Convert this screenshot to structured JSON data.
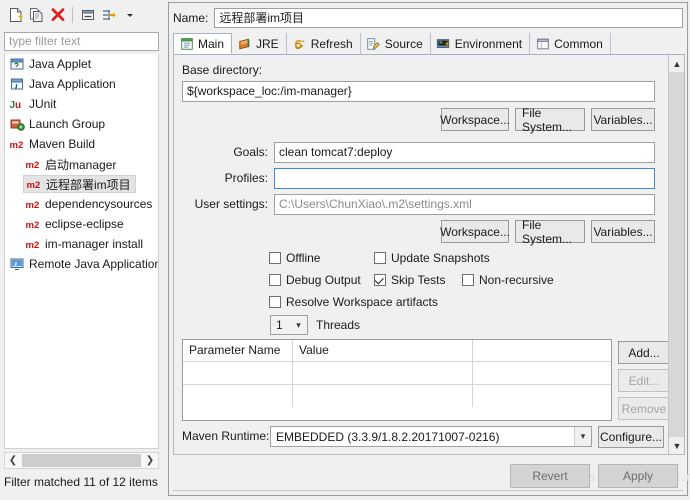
{
  "left_toolbar": {
    "buttons": [
      {
        "name": "new-launch-configuration-icon",
        "label": "New"
      },
      {
        "name": "duplicate-launch-configuration-icon",
        "label": "Duplicate"
      },
      {
        "name": "delete-launch-configuration-icon",
        "label": "Delete"
      },
      {
        "name": "collapse-all-icon",
        "label": "Collapse All"
      },
      {
        "name": "filter-launch-configurations-icon",
        "label": "Filter"
      },
      {
        "name": "view-menu-chevron-icon",
        "label": "View Menu"
      }
    ]
  },
  "filter": {
    "placeholder": "type filter text",
    "value": "",
    "status": "Filter matched 11 of 12 items"
  },
  "tree": {
    "items": [
      {
        "label": "Java Applet",
        "icon": "java-applet-icon",
        "indent": false,
        "selected": false
      },
      {
        "label": "Java Application",
        "icon": "java-application-icon",
        "indent": false,
        "selected": false
      },
      {
        "label": "JUnit",
        "icon": "junit-icon",
        "indent": false,
        "selected": false
      },
      {
        "label": "Launch Group",
        "icon": "launch-group-icon",
        "indent": false,
        "selected": false
      },
      {
        "label": "Maven Build",
        "icon": "maven-icon",
        "indent": false,
        "selected": false
      },
      {
        "label": "启动manager",
        "icon": "maven-icon",
        "indent": true,
        "selected": false
      },
      {
        "label": "远程部署im项目",
        "icon": "maven-icon",
        "indent": true,
        "selected": true
      },
      {
        "label": "dependencysources",
        "icon": "maven-icon",
        "indent": true,
        "selected": false
      },
      {
        "label": "eclipse-eclipse",
        "icon": "maven-icon",
        "indent": true,
        "selected": false
      },
      {
        "label": "im-manager install",
        "icon": "maven-icon",
        "indent": true,
        "selected": false
      },
      {
        "label": "Remote Java Application",
        "icon": "remote-java-application-icon",
        "indent": false,
        "selected": false
      }
    ]
  },
  "name_field": {
    "label": "Name:",
    "value": "远程部署im项目"
  },
  "tabs": [
    {
      "label": "Main",
      "icon": "main-tab-icon",
      "active": true
    },
    {
      "label": "JRE",
      "icon": "jre-tab-icon",
      "active": false
    },
    {
      "label": "Refresh",
      "icon": "refresh-tab-icon",
      "active": false
    },
    {
      "label": "Source",
      "icon": "source-tab-icon",
      "active": false
    },
    {
      "label": "Environment",
      "icon": "environment-tab-icon",
      "active": false
    },
    {
      "label": "Common",
      "icon": "common-tab-icon",
      "active": false
    }
  ],
  "main_tab": {
    "base_directory": {
      "label": "Base directory:",
      "value": "${workspace_loc:/im-manager}"
    },
    "base_dir_buttons": [
      {
        "label": "Workspace...",
        "name": "base-dir-workspace-button"
      },
      {
        "label": "File System...",
        "name": "base-dir-file-system-button"
      },
      {
        "label": "Variables...",
        "name": "base-dir-variables-button"
      }
    ],
    "goals": {
      "label": "Goals:",
      "value": "clean tomcat7:deploy"
    },
    "profiles": {
      "label": "Profiles:",
      "value": ""
    },
    "user_settings": {
      "label": "User settings:",
      "value": "C:\\Users\\ChunXiao\\.m2\\settings.xml"
    },
    "settings_buttons": [
      {
        "label": "Workspace...",
        "name": "settings-workspace-button"
      },
      {
        "label": "File System...",
        "name": "settings-file-system-button"
      },
      {
        "label": "Variables...",
        "name": "settings-variables-button"
      }
    ],
    "checkboxes": [
      {
        "label": "Offline",
        "checked": false,
        "name": "offline-checkbox"
      },
      {
        "label": "Update Snapshots",
        "checked": false,
        "name": "update-snapshots-checkbox"
      },
      {
        "label": "Debug Output",
        "checked": false,
        "name": "debug-output-checkbox"
      },
      {
        "label": "Skip Tests",
        "checked": true,
        "name": "skip-tests-checkbox"
      },
      {
        "label": "Non-recursive",
        "checked": false,
        "name": "non-recursive-checkbox"
      },
      {
        "label": "Resolve Workspace artifacts",
        "checked": false,
        "name": "resolve-workspace-artifacts-checkbox"
      }
    ],
    "threads": {
      "value": "1",
      "label": "Threads"
    },
    "parameter_table": {
      "columns": [
        "Parameter Name",
        "Value"
      ],
      "rows": []
    },
    "table_buttons": [
      {
        "label": "Add...",
        "name": "add-parameter-button",
        "enabled": true
      },
      {
        "label": "Edit...",
        "name": "edit-parameter-button",
        "enabled": false
      },
      {
        "label": "Remove",
        "name": "remove-parameter-button",
        "enabled": false
      }
    ],
    "maven_runtime": {
      "label": "Maven Runtime:",
      "value": "EMBEDDED (3.3.9/1.8.2.20171007-0216)",
      "configure_label": "Configure..."
    }
  },
  "footer": {
    "revert_label": "Revert",
    "apply_label": "Apply",
    "watermark": "https://blog.csdn.net/yex001221"
  },
  "colors": {
    "maven_red": "#cc1111",
    "accent_blue": "#3c8ad9",
    "panel_bg": "#f0f0f0"
  }
}
